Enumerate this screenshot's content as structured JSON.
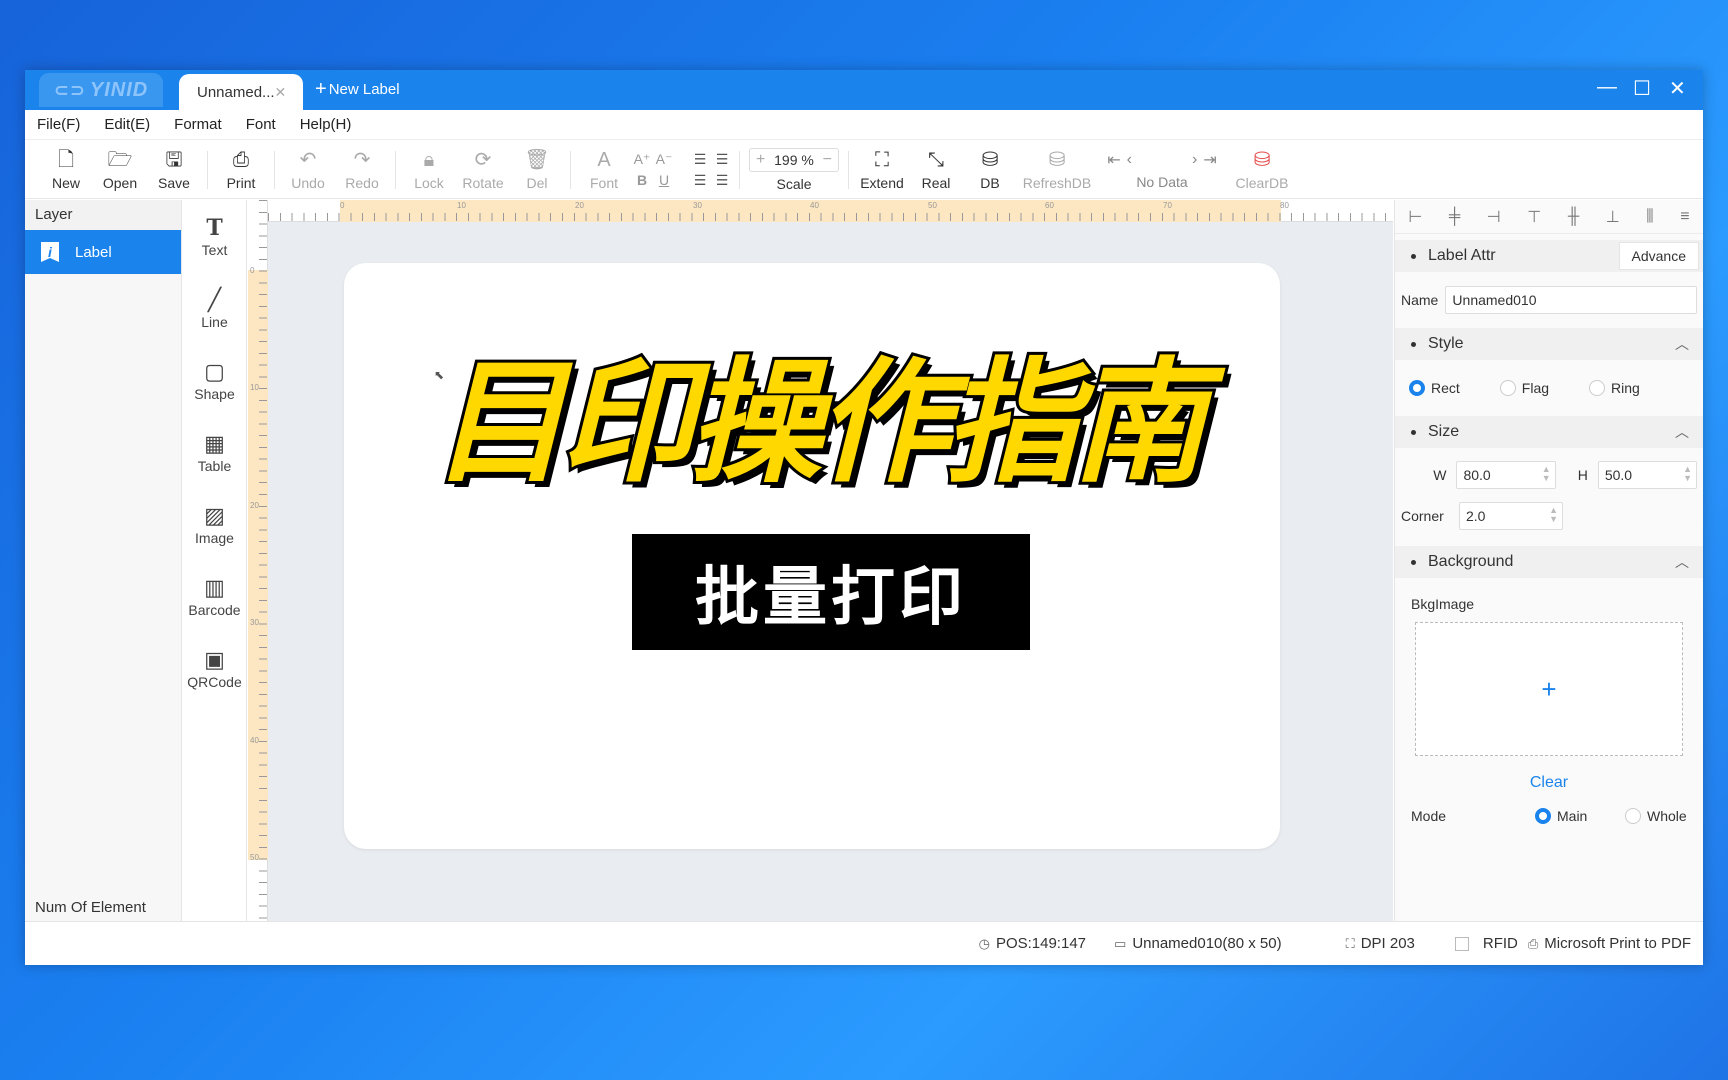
{
  "titlebar": {
    "logo": "YINID",
    "tab_label": "Unnamed...",
    "new_label": "New Label"
  },
  "menu": [
    "File(F)",
    "Edit(E)",
    "Format",
    "Font",
    "Help(H)"
  ],
  "toolbar": {
    "new": "New",
    "open": "Open",
    "save": "Save",
    "print": "Print",
    "undo": "Undo",
    "redo": "Redo",
    "lock": "Lock",
    "rotate": "Rotate",
    "del": "Del",
    "font": "Font",
    "scale_value": "199 %",
    "scale": "Scale",
    "extend": "Extend",
    "real": "Real",
    "db": "DB",
    "refreshdb": "RefreshDB",
    "nodata": "No Data",
    "cleardb": "ClearDB"
  },
  "layer": {
    "header": "Layer",
    "item": "Label",
    "footer": "Num Of Element"
  },
  "tools": [
    "Text",
    "Line",
    "Shape",
    "Table",
    "Image",
    "Barcode",
    "QRCode"
  ],
  "canvas": {
    "title_text": "目印操作指南",
    "sub_text": "批量打印",
    "ruler_top": [
      "0",
      "10",
      "20",
      "30",
      "40",
      "50",
      "60",
      "70",
      "80"
    ],
    "ruler_left": [
      "0",
      "10",
      "20",
      "30",
      "40",
      "50"
    ]
  },
  "props": {
    "label_attr": "Label Attr",
    "advance": "Advance",
    "name_label": "Name",
    "name_value": "Unnamed010",
    "style": "Style",
    "style_options": [
      "Rect",
      "Flag",
      "Ring"
    ],
    "size": "Size",
    "w_label": "W",
    "w_value": "80.0",
    "h_label": "H",
    "h_value": "50.0",
    "corner_label": "Corner",
    "corner_value": "2.0",
    "background": "Background",
    "bkgimage": "BkgImage",
    "clear": "Clear",
    "mode_label": "Mode",
    "mode_options": [
      "Main",
      "Whole"
    ]
  },
  "status": {
    "pos": "POS:149:147",
    "file": "Unnamed010(80 x 50)",
    "dpi": "DPI 203",
    "rfid": "RFID",
    "printer": "Microsoft Print to PDF"
  },
  "colors": {
    "accent": "#1b84ec",
    "title_yellow": "#ffd800"
  }
}
